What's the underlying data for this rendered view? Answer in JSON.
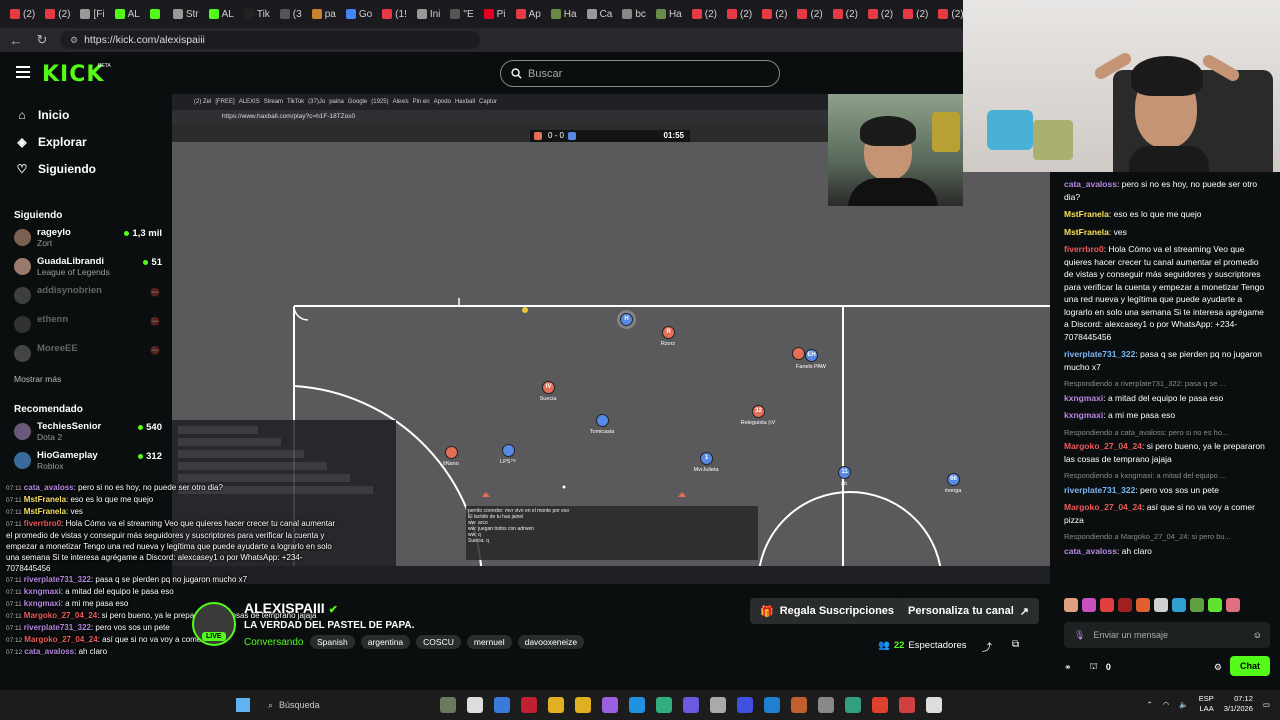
{
  "browser": {
    "tabs": [
      "(2)",
      "(2)",
      "[Fi",
      "AL",
      "",
      "Str",
      "AL",
      "Tik",
      "(3",
      "pa",
      "Go",
      "(1!",
      "Ini",
      "\"E",
      "Pi",
      "Ap",
      "Ha",
      "Ca",
      "bc",
      "Ha",
      "(2)",
      "(2)",
      "(2)",
      "(2)",
      "(2)",
      "(2)",
      "(2)",
      "(2)",
      "(2)",
      "(2)"
    ],
    "url": "https://kick.com/alexispaiii"
  },
  "header": {
    "logo": "KICK",
    "logo_beta": "BETA",
    "search_placeholder": "Buscar"
  },
  "sidebar": {
    "nav": [
      {
        "label": "Inicio",
        "icon": "home-icon"
      },
      {
        "label": "Explorar",
        "icon": "compass-icon"
      },
      {
        "label": "Siguiendo",
        "icon": "heart-icon"
      }
    ],
    "following_title": "Siguiendo",
    "following": [
      {
        "name": "rageylo",
        "sub": "Zort",
        "count": "1,3 mil",
        "online": true
      },
      {
        "name": "GuadaLibrandi",
        "sub": "League of Legends",
        "count": "51",
        "online": true
      },
      {
        "name": "addisynobrien",
        "sub": "",
        "count": "",
        "online": false
      },
      {
        "name": "ethenn",
        "sub": "",
        "count": "",
        "online": false
      },
      {
        "name": "MoreeEE",
        "sub": "",
        "count": "",
        "online": false
      }
    ],
    "show_more": "Mostrar más",
    "recommended_title": "Recomendado",
    "recommended": [
      {
        "name": "TechiesSenior",
        "sub": "Dota 2",
        "count": "540"
      },
      {
        "name": "HioGameplay",
        "sub": "Roblox",
        "count": "312"
      }
    ]
  },
  "video": {
    "inner_tabs": [
      "(2) Zel",
      "[FREE]",
      "ALEXIS",
      "Stream",
      "TikTok",
      "(37)Jo",
      "paina",
      "Google",
      "(1925)",
      "Alexis",
      "Pin en",
      "Apodo",
      "Haxball",
      "Captur"
    ],
    "inner_url": "https://www.haxball.com/play?c=h1F-18TZos0",
    "score": "0 - 0",
    "time": "01:55",
    "players": [
      {
        "num": "R",
        "name": "Rzorz",
        "team": "red"
      },
      {
        "num": "IV",
        "name": "Suecia",
        "team": "red"
      },
      {
        "num": "32",
        "name": "Releguista (ıV",
        "team": "red"
      },
      {
        "num": "",
        "name": "liNano",
        "team": "red"
      },
      {
        "num": "",
        "name": "Tomicasia",
        "team": "blue"
      },
      {
        "num": "1",
        "name": "MvrJulieta",
        "team": "blue"
      },
      {
        "num": "11",
        "name": "ab",
        "team": "blue"
      },
      {
        "num": "66",
        "name": "riverga",
        "team": "blue"
      },
      {
        "num": "",
        "name": "LPS™",
        "team": "blue"
      },
      {
        "num": "EH",
        "name": "Fanels PAW",
        "team": "blue"
      },
      {
        "num": "H",
        "name": "",
        "team": "blue"
      }
    ],
    "game_chat": [
      "perrito corredor: mvr vivo en el monte por eso",
      "El lactido de tu has jainel",
      "ww: arco",
      "ww: juegan todos con adrwen",
      "ww: q",
      "Suecia: q"
    ]
  },
  "overlay_chat": [
    {
      "time": "07:11",
      "user": "cata_avaloss",
      "text": "pero si no es hoy, no puede ser otro dia?",
      "cls": "u"
    },
    {
      "time": "07:11",
      "user": "MstFranela",
      "text": "eso es lo que me quejo",
      "cls": "uy"
    },
    {
      "time": "07:11",
      "user": "MstFranela",
      "text": "ves",
      "cls": "uy"
    },
    {
      "time": "07:11",
      "user": "fiverrbro0",
      "text": "Hola Cómo va el streaming Veo que quieres hacer crecer tu canal aumentar el promedio de vistas y conseguir más seguidores y suscriptores para verificar la cuenta y empezar a monetizar Tengo una red nueva y legítima que puede ayudarte a lograrlo en solo una semana Si te interesa agrégame a Discord: alexcasey1 o por WhatsApp: +234-7078445456",
      "cls": "ur"
    },
    {
      "time": "07:11",
      "user": "riverplate731_322",
      "text": "pasa q se pierden pq no jugaron mucho x7",
      "cls": "u"
    },
    {
      "time": "07:11",
      "user": "kxngmaxi",
      "text": "a mitad del equipo le pasa eso",
      "cls": "u"
    },
    {
      "time": "07:11",
      "user": "kxngmaxi",
      "text": "a mi me pasa eso",
      "cls": "u"
    },
    {
      "time": "07:11",
      "user": "Margoko_27_04_24",
      "text": "si pero bueno, ya le prepararon las cosas de temprano jajaja",
      "cls": "ur"
    },
    {
      "time": "07:11",
      "user": "riverplate731_322",
      "text": "pero vos sos un pete",
      "cls": "u"
    },
    {
      "time": "07:12",
      "user": "Margoko_27_04_24",
      "text": "así que si no va voy a comer pizza",
      "cls": "ur"
    },
    {
      "time": "07:12",
      "user": "cata_avaloss",
      "text": "ah claro",
      "cls": "u"
    }
  ],
  "streamer": {
    "name": "ALEXISPAIII",
    "title": "LA VERDAD DEL PASTEL DE PAPA.",
    "category": "Conversando",
    "live": "LIVE",
    "tags": [
      "Spanish",
      "argentina",
      "COSCU",
      "mernuel",
      "davooxeneize"
    ],
    "gift_button": "Regala Suscripciones",
    "customize_button": "Personaliza tu canal",
    "viewers_count": "22",
    "viewers_label": "Espectadores"
  },
  "chat": {
    "messages": [
      {
        "reply": "",
        "user": "cata_avaloss",
        "color": "#b887e3",
        "text": "pero si no es hoy, no puede ser otro dia?"
      },
      {
        "reply": "",
        "user": "MstFranela",
        "color": "#f6e05e",
        "text": "eso es lo que me quejo"
      },
      {
        "reply": "",
        "user": "MstFranela",
        "color": "#f6e05e",
        "text": "ves"
      },
      {
        "reply": "",
        "user": "fiverrbro0",
        "color": "#ee5a5a",
        "text": "Hola Cómo va el streaming Veo que quieres hacer crecer tu canal aumentar el promedio de vistas y conseguir más seguidores y suscriptores para verificar la cuenta y empezar a monetizar Tengo una red nueva y legítima que puede ayudarte a lograrlo en solo una semana Si te interesa agrégame a Discord: alexcasey1 o por WhatsApp: +234-7078445456"
      },
      {
        "reply": "",
        "user": "riverplate731_322",
        "color": "#7ab8f5",
        "text": "pasa q se pierden pq no jugaron mucho x7"
      },
      {
        "reply": "Respondiendo a riverplate731_322: pasa q se ...",
        "user": "kxngmaxi",
        "color": "#b887e3",
        "text": "a mitad del equipo le pasa eso"
      },
      {
        "reply": "",
        "user": "kxngmaxi",
        "color": "#b887e3",
        "text": "a mi me pasa eso"
      },
      {
        "reply": "Respondiendo a cata_avaloss: pero si no es ho...",
        "user": "Margoko_27_04_24",
        "color": "#ee5a5a",
        "text": "si pero bueno, ya le prepararon las cosas de temprano jajaja"
      },
      {
        "reply": "Respondiendo a kxngmaxi: a mitad del equipo ...",
        "user": "riverplate731_322",
        "color": "#7ab8f5",
        "text": "pero vos sos un pete"
      },
      {
        "reply": "",
        "user": "Margoko_27_04_24",
        "color": "#ee5a5a",
        "text": "así que si no va voy a comer pizza"
      },
      {
        "reply": "Respondiendo a Margoko_27_04_24: si pero bu...",
        "user": "cata_avaloss",
        "color": "#b887e3",
        "text": "ah claro"
      }
    ],
    "input_placeholder": "Enviar un mensaje",
    "points": "0",
    "send_button": "Chat"
  },
  "taskbar": {
    "search_placeholder": "Búsqueda",
    "lang": "ESP",
    "lang2": "LAA",
    "time": "07:12",
    "date": "3/1/2026"
  },
  "colors": {
    "brand_green": "#53fc18",
    "background": "#0b0e0f"
  }
}
